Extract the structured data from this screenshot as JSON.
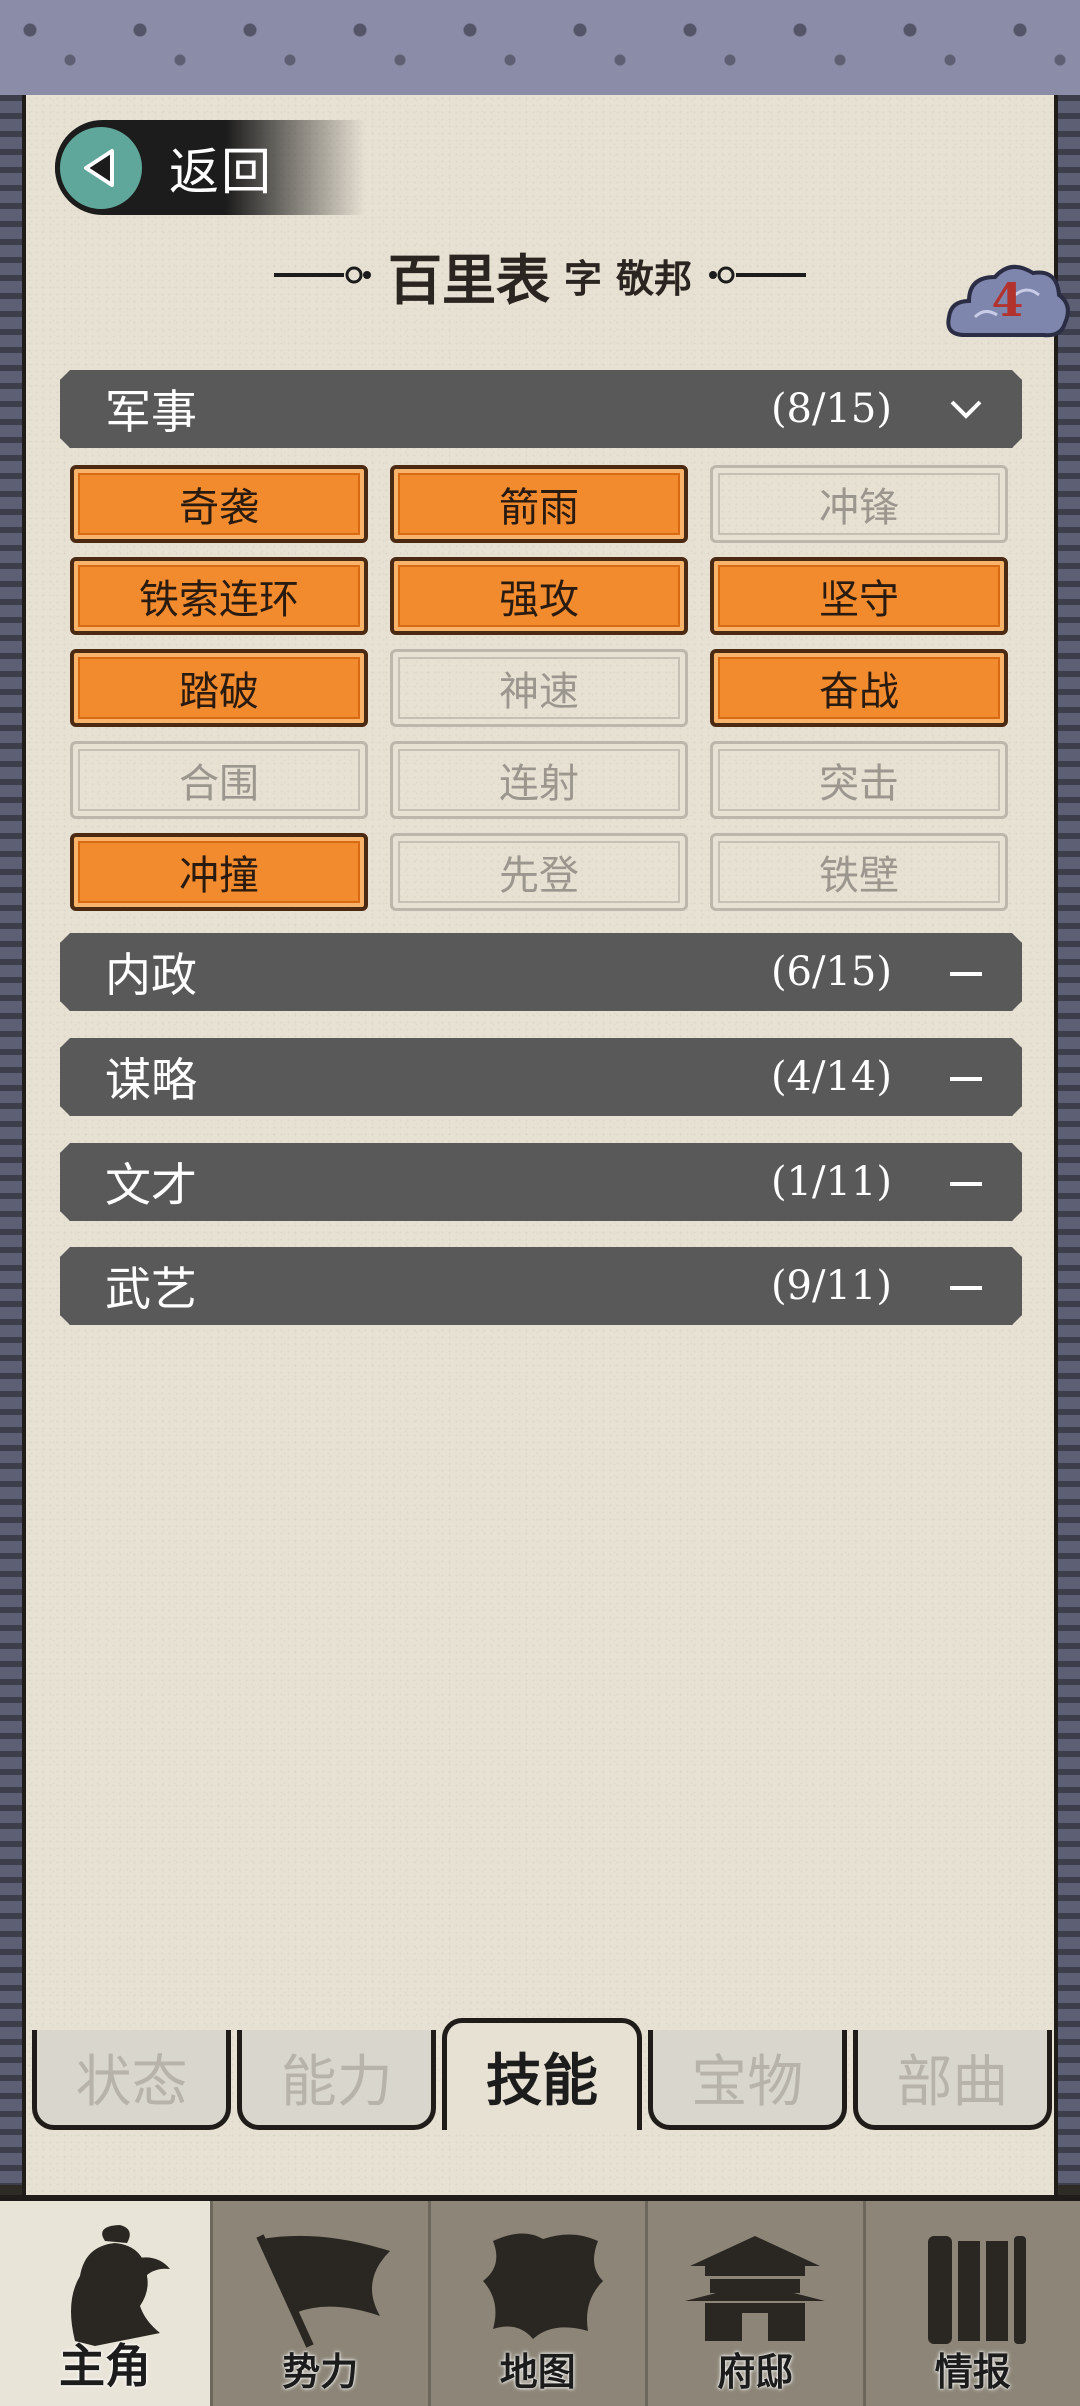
{
  "header": {
    "back_label": "返回",
    "name": "百里表",
    "zi_label": "字",
    "courtesy_name": "敬邦",
    "badge_count": "4"
  },
  "categories": [
    {
      "name": "军事",
      "count": "(8/15)",
      "expanded": true
    },
    {
      "name": "内政",
      "count": "(6/15)",
      "expanded": false
    },
    {
      "name": "谋略",
      "count": "(4/14)",
      "expanded": false
    },
    {
      "name": "文才",
      "count": "(1/11)",
      "expanded": false
    },
    {
      "name": "武艺",
      "count": "(9/11)",
      "expanded": false
    }
  ],
  "military_skills": [
    {
      "label": "奇袭",
      "learned": true
    },
    {
      "label": "箭雨",
      "learned": true
    },
    {
      "label": "冲锋",
      "learned": false
    },
    {
      "label": "铁索连环",
      "learned": true
    },
    {
      "label": "强攻",
      "learned": true
    },
    {
      "label": "坚守",
      "learned": true
    },
    {
      "label": "踏破",
      "learned": true
    },
    {
      "label": "神速",
      "learned": false
    },
    {
      "label": "奋战",
      "learned": true
    },
    {
      "label": "合围",
      "learned": false
    },
    {
      "label": "连射",
      "learned": false
    },
    {
      "label": "突击",
      "learned": false
    },
    {
      "label": "冲撞",
      "learned": true
    },
    {
      "label": "先登",
      "learned": false
    },
    {
      "label": "铁壁",
      "learned": false
    }
  ],
  "section_tabs": [
    {
      "label": "状态",
      "active": false
    },
    {
      "label": "能力",
      "active": false
    },
    {
      "label": "技能",
      "active": true
    },
    {
      "label": "宝物",
      "active": false
    },
    {
      "label": "部曲",
      "active": false
    }
  ],
  "bottom_nav": [
    {
      "label": "主角",
      "icon": "warrior-portrait-icon",
      "active": true
    },
    {
      "label": "势力",
      "icon": "flag-icon",
      "active": false
    },
    {
      "label": "地图",
      "icon": "map-icon",
      "active": false
    },
    {
      "label": "府邸",
      "icon": "mansion-icon",
      "active": false
    },
    {
      "label": "情报",
      "icon": "scroll-icon",
      "active": false
    }
  ],
  "colors": {
    "skill_learned": "#f28a2e",
    "header_bar": "#595959",
    "paper": "#e7e1d3",
    "badge_number": "#b2322e",
    "back_circle": "#5fa79a"
  }
}
